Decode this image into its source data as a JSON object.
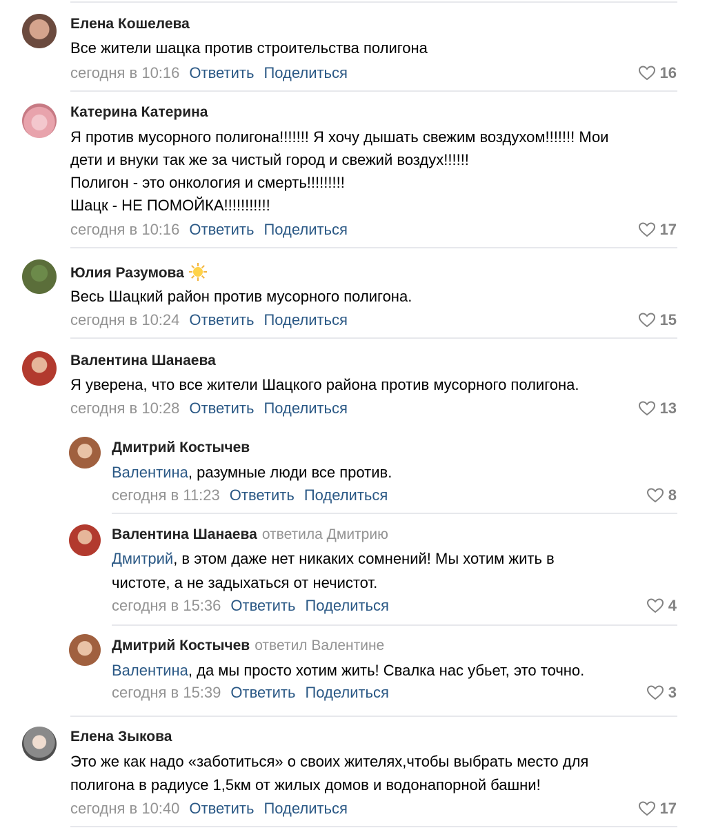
{
  "comments": [
    {
      "author": "Елена Кошелева",
      "lines": [
        "Все жители шацка против строительства полигона"
      ],
      "time": "сегодня в 10:16",
      "reply_label": "Ответить",
      "share_label": "Поделиться",
      "likes": "16",
      "avatar_color": "#6b4a3e"
    },
    {
      "author": "Катерина Катерина",
      "lines": [
        "Я против мусорного полигона!!!!!!! Я хочу дышать свежим воздухом!!!!!!! Мои",
        "дети и внуки так же за чистый город и свежий воздух!!!!!!",
        "Полигон - это онкология и смерть!!!!!!!!!",
        "Шацк - НЕ ПОМОЙКА!!!!!!!!!!!"
      ],
      "time": "сегодня в 10:16",
      "reply_label": "Ответить",
      "share_label": "Поделиться",
      "likes": "17",
      "avatar_color": "#e8a3ac"
    },
    {
      "author": "Юлия Разумова",
      "badge_icon": "sun-emoji",
      "lines": [
        "Весь Шацкий район против мусорного полигона."
      ],
      "time": "сегодня в 10:24",
      "reply_label": "Ответить",
      "share_label": "Поделиться",
      "likes": "15",
      "avatar_color": "#5b6e3a"
    },
    {
      "author": "Валентина Шанаева",
      "lines": [
        "Я уверена, что все жители Шацкого района против мусорного полигона."
      ],
      "time": "сегодня в 10:28",
      "reply_label": "Ответить",
      "share_label": "Поделиться",
      "likes": "13",
      "avatar_color": "#b23a2e"
    },
    {
      "author": "Дмитрий Костычев",
      "mention": "Валентина",
      "lines": [
        ", разумные люди все против."
      ],
      "time": "сегодня в 11:23",
      "reply_label": "Ответить",
      "share_label": "Поделиться",
      "likes": "8",
      "avatar_color": "#a0603f"
    },
    {
      "author": "Валентина Шанаева",
      "reply_to": "ответила Дмитрию",
      "mention": "Дмитрий",
      "lines": [
        ", в этом даже нет никаких сомнений! Мы хотим жить в",
        "чистоте, а не задыхаться от нечистот."
      ],
      "time": "сегодня в 15:36",
      "reply_label": "Ответить",
      "share_label": "Поделиться",
      "likes": "4",
      "avatar_color": "#b23a2e"
    },
    {
      "author": "Дмитрий Костычев",
      "reply_to": "ответил Валентине",
      "mention": "Валентина",
      "lines": [
        ", да мы просто хотим жить! Свалка нас убьет, это точно."
      ],
      "time": "сегодня в 15:39",
      "reply_label": "Ответить",
      "share_label": "Поделиться",
      "likes": "3",
      "avatar_color": "#a0603f"
    },
    {
      "author": "Елена Зыкова",
      "lines": [
        "Это же как надо «заботиться» о своих жителях,чтобы выбрать место для",
        "полигона в радиусе 1,5км от жилых домов и водонапорной башни!"
      ],
      "time": "сегодня в 10:40",
      "reply_label": "Ответить",
      "share_label": "Поделиться",
      "likes": "17",
      "avatar_color": "#8a8a8a"
    }
  ],
  "colors": {
    "link": "#2a5885",
    "muted": "#939393",
    "like": "#828282",
    "separator": "#e7e8ec"
  }
}
